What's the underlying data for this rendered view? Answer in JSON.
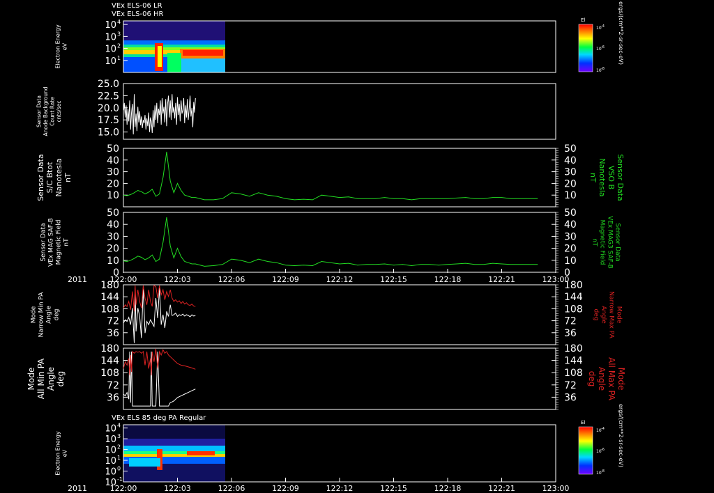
{
  "colors": {
    "background": "#000000",
    "axis": "#ffffff",
    "white_trace": "#ffffff",
    "green_trace": "#22dd22",
    "green_label": "#22dd22",
    "red_trace": "#dd2222",
    "red_label": "#dd2222"
  },
  "chart_data": [
    {
      "type": "heatmap",
      "id": "p1",
      "titles": [
        "VEx ELS-06 LR",
        "VEx ELS-06 HR"
      ],
      "ylabel": [
        "Electron Energy",
        "eV"
      ],
      "yscale": "log",
      "ylim": [
        1,
        20000
      ],
      "y_ticks": [
        10,
        100,
        1000,
        10000
      ],
      "y_tick_labels": [
        "10",
        "10",
        "10",
        "10"
      ],
      "y_tick_exps": [
        "1",
        "2",
        "3",
        "4"
      ],
      "colorbar": {
        "title": "El",
        "unit_label": "ergs/(cm**2-sr-sec-eV)",
        "tick_bases": [
          "10",
          "10",
          "10"
        ],
        "tick_exps": [
          "-4",
          "-6",
          "-8"
        ]
      },
      "data_extent_x": [
        "122:00",
        "122:06"
      ]
    },
    {
      "type": "line",
      "id": "p2",
      "ylabel": [
        "Sensor Data",
        "Anode Background",
        "Count Rate",
        "cnts/sec"
      ],
      "ylim": [
        13.5,
        25.0
      ],
      "y_ticks": [
        15.0,
        17.5,
        20.0,
        22.5,
        25.0
      ],
      "y_tick_labels": [
        "15.0",
        "17.5",
        "20.0",
        "22.5",
        "25.0"
      ],
      "series": [
        {
          "color_key": "white_trace",
          "x": [
            122.01,
            122.05,
            122.1,
            122.15,
            122.2,
            122.25,
            122.3,
            122.35,
            122.4,
            122.45,
            122.5,
            122.55,
            122.6,
            122.65,
            122.7,
            122.75,
            122.8,
            122.85,
            122.9,
            122.95,
            123.0,
            123.05,
            123.1,
            123.15,
            123.2,
            123.25,
            123.3,
            123.35,
            123.4,
            123.45,
            123.5,
            123.55,
            123.6,
            123.65,
            123.7,
            123.75,
            123.8,
            123.85,
            123.9,
            123.95,
            124.0,
            124.05,
            124.1,
            124.15,
            124.2,
            124.25,
            124.3,
            124.35,
            124.4,
            124.45,
            124.5,
            124.55,
            124.6,
            124.65,
            124.7,
            124.75,
            124.8,
            124.85,
            124.9,
            124.95,
            125.0,
            125.05,
            125.1,
            125.15,
            125.2,
            125.25,
            125.3,
            125.35,
            125.4,
            125.45,
            125.5,
            125.55,
            125.6,
            125.65,
            125.7,
            125.75,
            125.8,
            125.85,
            125.9,
            125.95,
            126.0
          ],
          "y": [
            19.5,
            21.0,
            18.0,
            20.5,
            16.5,
            19.8,
            17.2,
            21.5,
            15.5,
            19.0,
            20.8,
            14.5,
            22.8,
            16.0,
            18.8,
            15.2,
            20.2,
            17.0,
            19.3,
            16.4,
            18.2,
            15.8,
            17.5,
            16.8,
            18.5,
            15.5,
            17.8,
            16.2,
            19.0,
            15.0,
            18.0,
            17.2,
            14.8,
            19.5,
            16.0,
            20.5,
            17.5,
            21.0,
            16.8,
            19.8,
            18.5,
            21.5,
            16.5,
            22.0,
            18.8,
            20.2,
            17.0,
            21.8,
            16.2,
            20.8,
            22.5,
            18.0,
            21.5,
            17.5,
            22.8,
            19.0,
            20.2,
            17.8,
            21.0,
            16.5,
            22.2,
            18.5,
            20.8,
            17.2,
            21.5,
            18.8,
            19.5,
            22.0,
            16.8,
            20.5,
            18.0,
            21.8,
            17.5,
            19.8,
            22.5,
            18.2,
            20.0,
            16.0,
            21.2,
            19.0,
            22.0
          ]
        }
      ]
    },
    {
      "type": "line",
      "id": "p3",
      "ylabel": [
        "Sensor Data",
        "S/C Btot",
        "Nanotesla",
        "nT"
      ],
      "right_label": [
        "Sensor Data",
        "VSO B",
        "Nanotesla",
        "nT"
      ],
      "ylim": [
        0,
        50
      ],
      "y_ticks": [
        10,
        20,
        30,
        40,
        50
      ],
      "y_tick_labels": [
        "10",
        "20",
        "30",
        "40",
        "50"
      ],
      "series": [
        {
          "color_key": "green_trace",
          "x": [
            122.0,
            122.2,
            122.4,
            122.6,
            122.8,
            123.0,
            123.2,
            123.4,
            123.6,
            123.8,
            124.0,
            124.2,
            124.4,
            124.6,
            124.8,
            125.0,
            125.2,
            125.4,
            125.6,
            125.8,
            126.0,
            126.5,
            127.0,
            127.5,
            128.0,
            128.5,
            129.0,
            129.5,
            130.0,
            130.5,
            131.0,
            131.5,
            132.0,
            132.5,
            133.0,
            133.5,
            134.0,
            134.5,
            135.0,
            135.5,
            136.0,
            136.5,
            137.0,
            137.5,
            138.0,
            138.5,
            139.0,
            139.5,
            140.0,
            140.5,
            141.0,
            141.5,
            142.0,
            142.5,
            143.0,
            143.5,
            144.0,
            144.5,
            145.0
          ],
          "y": [
            10.0,
            9.5,
            10.5,
            12.0,
            14.0,
            13.0,
            11.0,
            12.5,
            15.0,
            9.0,
            11.0,
            25.0,
            47.0,
            22.0,
            12.0,
            20.0,
            14.0,
            10.0,
            9.0,
            8.0,
            8.0,
            6.0,
            6.0,
            7.0,
            12.0,
            11.0,
            9.0,
            12.0,
            10.0,
            9.0,
            7.0,
            6.0,
            6.5,
            6.0,
            10.0,
            9.0,
            8.0,
            8.5,
            7.0,
            7.0,
            7.0,
            8.0,
            7.0,
            7.0,
            6.0,
            7.0,
            7.0,
            7.0,
            7.0,
            7.5,
            8.0,
            7.0,
            7.0,
            8.0,
            8.0,
            7.0,
            7.0,
            7.0,
            7.0
          ]
        }
      ]
    },
    {
      "type": "line",
      "id": "p4",
      "ylabel": [
        "Sensor Data",
        "VEx MAG SAF-B",
        "Magnetic Field",
        "nT"
      ],
      "right_label": [
        "Sensor Data",
        "VEx MAG3 SAF-B",
        "Magnetic Field",
        "nT"
      ],
      "ylim": [
        0,
        50
      ],
      "y_ticks": [
        0,
        10,
        20,
        30,
        40,
        50
      ],
      "y_tick_labels": [
        "0",
        "10",
        "20",
        "30",
        "40",
        "50"
      ],
      "xticks": [
        "122:00",
        "122:03",
        "122:06",
        "122:09",
        "122:12",
        "122:15",
        "122:18",
        "122:21",
        "123:00"
      ],
      "year_label": "2011",
      "series": [
        {
          "color_key": "green_trace",
          "x": [
            122.0,
            122.2,
            122.4,
            122.6,
            122.8,
            123.0,
            123.2,
            123.4,
            123.6,
            123.8,
            124.0,
            124.2,
            124.4,
            124.6,
            124.8,
            125.0,
            125.2,
            125.4,
            125.6,
            125.8,
            126.0,
            126.5,
            127.0,
            127.5,
            128.0,
            128.5,
            129.0,
            129.5,
            130.0,
            130.5,
            131.0,
            131.5,
            132.0,
            132.5,
            133.0,
            133.5,
            134.0,
            134.5,
            135.0,
            135.5,
            136.0,
            136.5,
            137.0,
            137.5,
            138.0,
            138.5,
            139.0,
            139.5,
            140.0,
            140.5,
            141.0,
            141.5,
            142.0,
            142.5,
            143.0,
            143.5,
            144.0,
            144.5,
            145.0
          ],
          "y": [
            9.5,
            9.0,
            10.0,
            11.5,
            13.5,
            12.5,
            10.5,
            12.0,
            14.5,
            9.0,
            11.0,
            25.0,
            46.0,
            22.0,
            12.0,
            20.0,
            13.0,
            9.0,
            8.0,
            7.0,
            7.0,
            5.0,
            5.5,
            6.5,
            11.0,
            10.0,
            8.0,
            11.0,
            9.0,
            8.0,
            6.0,
            5.5,
            6.0,
            5.5,
            9.0,
            8.0,
            7.0,
            7.5,
            6.0,
            6.5,
            6.5,
            7.0,
            6.0,
            6.5,
            5.5,
            6.5,
            6.5,
            6.0,
            6.5,
            7.0,
            7.5,
            6.5,
            6.5,
            7.5,
            7.0,
            6.5,
            6.5,
            6.5,
            6.5
          ]
        }
      ]
    },
    {
      "type": "line",
      "id": "p5",
      "ylabel": [
        "Mode",
        "Narrow Min PA",
        "Angle",
        "deg"
      ],
      "right_label": [
        "Mode",
        "Narrow Max PA",
        "Angle",
        "deg"
      ],
      "ylim": [
        0,
        180
      ],
      "y_ticks": [
        36,
        72,
        108,
        144,
        180
      ],
      "y_tick_labels": [
        "36",
        "72",
        "108",
        "144",
        "180"
      ],
      "series": [
        {
          "name": "",
          "color_key": "white_trace",
          "x": [
            122.0,
            122.1,
            122.2,
            122.3,
            122.4,
            122.5,
            122.6,
            122.65,
            122.7,
            122.8,
            122.9,
            123.0,
            123.1,
            123.2,
            123.3,
            123.4,
            123.5,
            123.6,
            123.7,
            123.8,
            123.9,
            124.0,
            124.1,
            124.2,
            124.3,
            124.4,
            124.5,
            124.6,
            124.7,
            124.8,
            124.9,
            125.0,
            125.1,
            125.2,
            125.3,
            125.4,
            125.5,
            125.6,
            125.7,
            125.8,
            125.9,
            126.0
          ],
          "y": [
            65,
            75,
            70,
            82,
            60,
            110,
            5,
            170,
            40,
            110,
            85,
            20,
            170,
            35,
            70,
            60,
            75,
            65,
            55,
            140,
            80,
            170,
            60,
            90,
            50,
            100,
            85,
            120,
            88,
            90,
            95,
            85,
            90,
            88,
            92,
            86,
            90,
            88,
            84,
            90,
            86,
            88
          ]
        },
        {
          "name": "",
          "color_key": "red_trace",
          "x": [
            122.0,
            122.1,
            122.2,
            122.3,
            122.4,
            122.5,
            122.6,
            122.65,
            122.7,
            122.8,
            122.9,
            123.0,
            123.1,
            123.2,
            123.3,
            123.4,
            123.5,
            123.6,
            123.7,
            123.8,
            123.9,
            124.0,
            124.1,
            124.2,
            124.3,
            124.4,
            124.5,
            124.6,
            124.7,
            124.8,
            124.9,
            125.0,
            125.1,
            125.2,
            125.3,
            125.4,
            125.5,
            125.6,
            125.7,
            125.8,
            125.9,
            126.0
          ],
          "y": [
            110,
            120,
            115,
            130,
            105,
            160,
            100,
            178,
            120,
            165,
            130,
            110,
            178,
            140,
            120,
            165,
            130,
            115,
            178,
            175,
            140,
            178,
            150,
            165,
            135,
            160,
            145,
            165,
            140,
            130,
            135,
            128,
            132,
            124,
            130,
            122,
            126,
            120,
            118,
            122,
            116,
            115
          ]
        }
      ]
    },
    {
      "type": "line",
      "id": "p6",
      "ylabel": [
        "Mode",
        "All Min PA",
        "Angle",
        "deg"
      ],
      "right_label": [
        "Mode",
        "All Max PA",
        "Angle",
        "deg"
      ],
      "ylim": [
        0,
        180
      ],
      "y_ticks": [
        36,
        72,
        108,
        144,
        180
      ],
      "y_tick_labels": [
        "36",
        "72",
        "108",
        "144",
        "180"
      ],
      "series": [
        {
          "name": "",
          "color_key": "white_trace",
          "x": [
            122.0,
            122.1,
            122.2,
            122.3,
            122.35,
            122.4,
            122.45,
            122.5,
            122.6,
            122.7,
            122.8,
            122.9,
            123.0,
            123.1,
            123.2,
            123.3,
            123.4,
            123.5,
            123.55,
            123.6,
            123.7,
            123.8,
            123.9,
            124.0,
            124.1,
            124.2,
            124.3,
            124.4,
            124.5,
            124.6,
            124.7,
            124.8,
            124.9,
            125.0,
            125.2,
            125.4,
            125.6,
            125.8,
            126.0
          ],
          "y": [
            45,
            40,
            50,
            30,
            170,
            20,
            170,
            10,
            10,
            10,
            10,
            10,
            10,
            10,
            10,
            10,
            10,
            10,
            170,
            10,
            10,
            10,
            170,
            10,
            10,
            10,
            10,
            10,
            10,
            20,
            22,
            25,
            30,
            35,
            40,
            45,
            50,
            55,
            60
          ]
        },
        {
          "name": "",
          "color_key": "red_trace",
          "x": [
            122.0,
            122.1,
            122.2,
            122.3,
            122.35,
            122.4,
            122.45,
            122.5,
            122.6,
            122.7,
            122.8,
            122.9,
            123.0,
            123.1,
            123.2,
            123.3,
            123.4,
            123.5,
            123.55,
            123.6,
            123.7,
            123.8,
            123.9,
            124.0,
            124.1,
            124.2,
            124.3,
            124.4,
            124.5,
            124.6,
            124.7,
            124.8,
            124.9,
            125.0,
            125.2,
            125.4,
            125.6,
            125.8,
            126.0
          ],
          "y": [
            120,
            140,
            130,
            150,
            100,
            160,
            110,
            170,
            165,
            170,
            168,
            170,
            165,
            170,
            130,
            170,
            120,
            150,
            100,
            170,
            140,
            178,
            120,
            170,
            160,
            175,
            165,
            170,
            160,
            155,
            150,
            145,
            140,
            135,
            130,
            128,
            125,
            122,
            118
          ]
        }
      ]
    },
    {
      "type": "heatmap",
      "id": "p7",
      "titles": [
        "VEx ELS 85 deg PA Regular"
      ],
      "ylabel": [
        "Electron Energy",
        "eV"
      ],
      "yscale": "log",
      "ylim": [
        0.1,
        20000
      ],
      "y_ticks": [
        0.1,
        1,
        10,
        100,
        1000,
        10000
      ],
      "y_tick_labels": [
        "10",
        "10",
        "10",
        "10",
        "10",
        "10"
      ],
      "y_tick_exps": [
        "-1",
        "0",
        "1",
        "2",
        "3",
        "4"
      ],
      "xticks": [
        "122:00",
        "122:03",
        "122:06",
        "122:09",
        "122:12",
        "122:15",
        "122:18",
        "122:21",
        "123:00"
      ],
      "year_label": "2011",
      "colorbar": {
        "title": "El",
        "unit_label": "ergs/(cm**2-sr-sec-eV)",
        "tick_bases": [
          "10",
          "10",
          "10"
        ],
        "tick_exps": [
          "-4",
          "-6",
          "-8"
        ]
      },
      "data_extent_x": [
        "122:00",
        "122:06"
      ]
    }
  ]
}
